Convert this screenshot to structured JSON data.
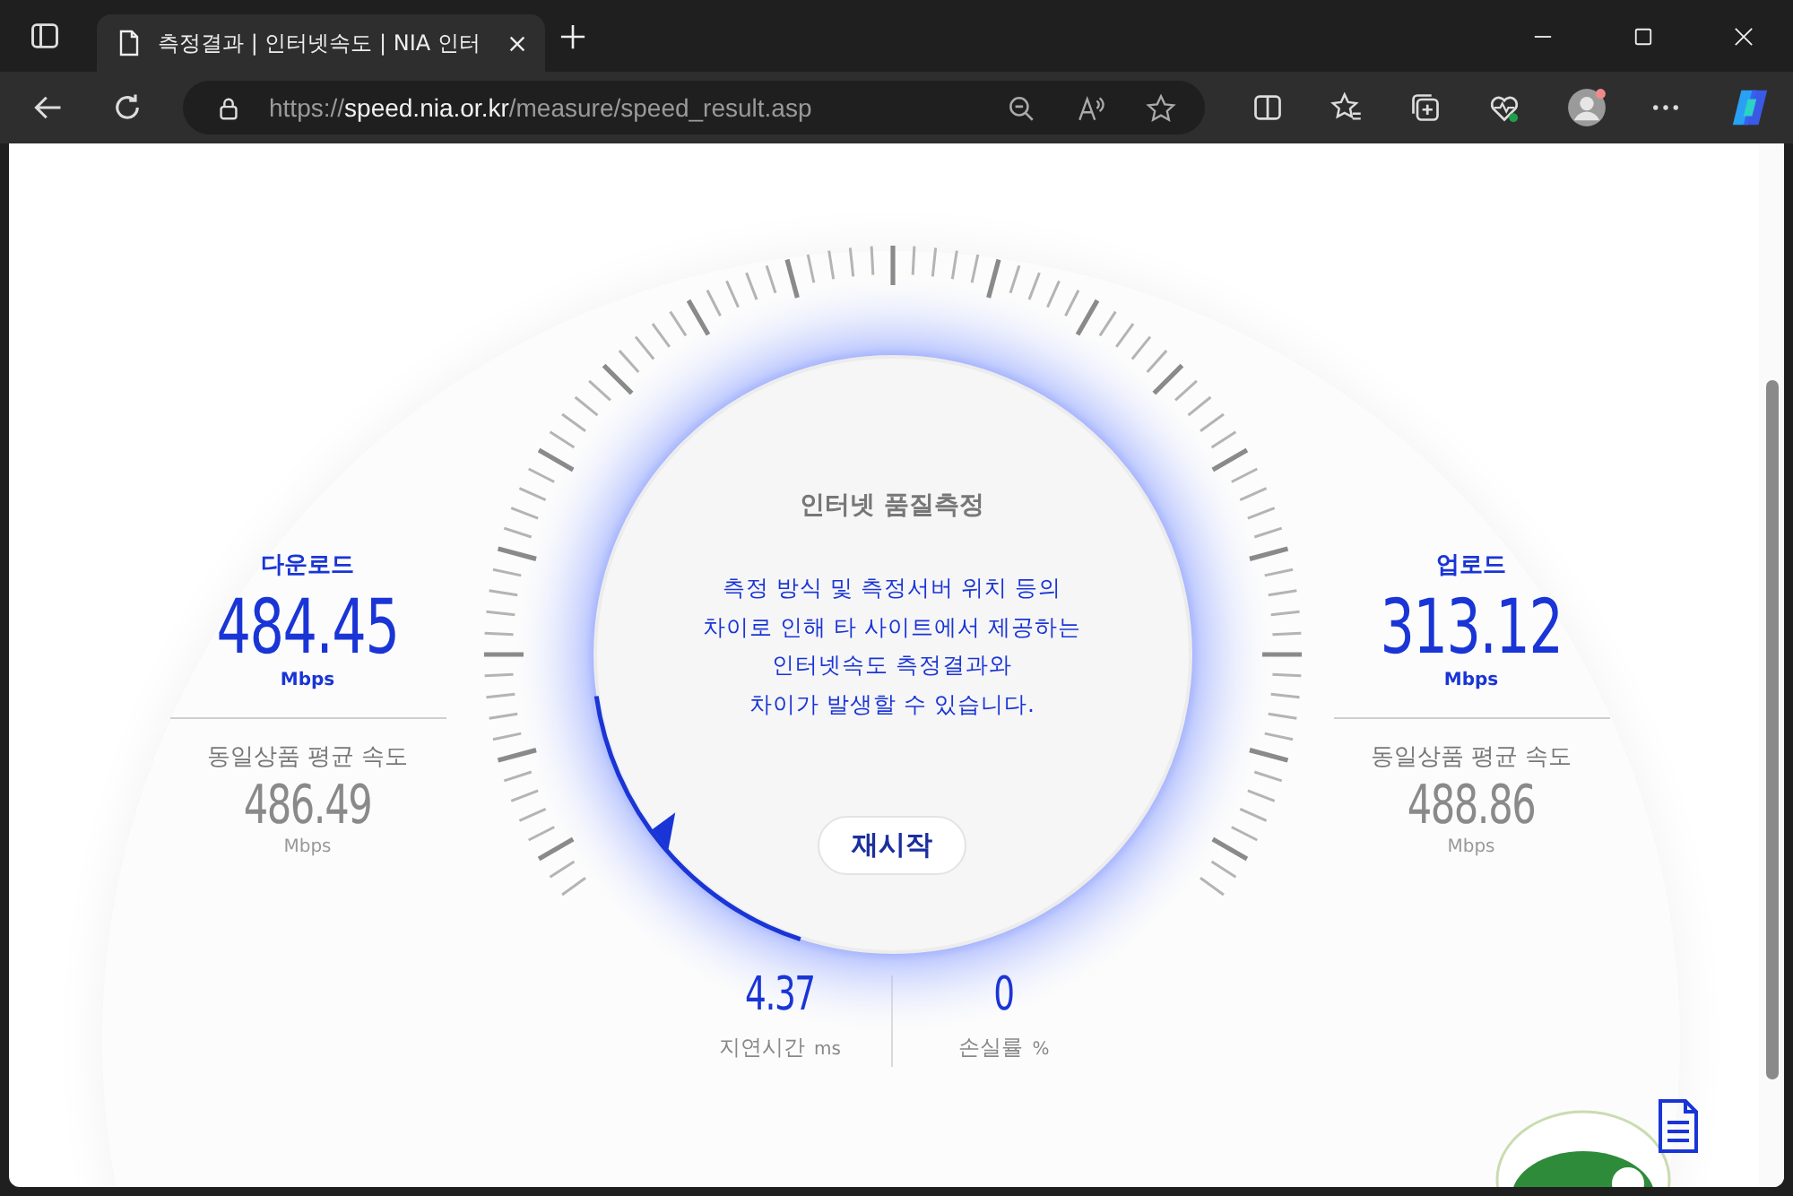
{
  "browser": {
    "tabs": [
      {
        "title": "측정결과 | 인터넷속도 | NIA 인터",
        "selected": true
      }
    ],
    "address": {
      "scheme": "https://",
      "host": "speed.nia.or.kr",
      "path": "/measure/speed_result.asp"
    }
  },
  "results": [
    {
      "label": "다운로드",
      "value": "484.45",
      "unit": "Mbps",
      "avg_label": "동일상품 평균 속도",
      "avg_value": "486.49",
      "avg_unit": "Mbps"
    },
    {
      "label": "업로드",
      "value": "313.12",
      "unit": "Mbps",
      "avg_label": "동일상품 평균 속도",
      "avg_value": "488.86",
      "avg_unit": "Mbps"
    }
  ],
  "gauge": {
    "title": "인터넷 품질측정",
    "message": "측정 방식 및 측정서버 위치 등의\n차이로 인해 타 사이트에서 제공하는\n인터넷속도 측정결과와\n차이가 발생할 수 있습니다.",
    "button": "재시작"
  },
  "metrics": [
    {
      "value": "4.37",
      "label": "지연시간",
      "unit": "ms"
    },
    {
      "value": "0",
      "label": "손실률",
      "unit": "%"
    }
  ]
}
